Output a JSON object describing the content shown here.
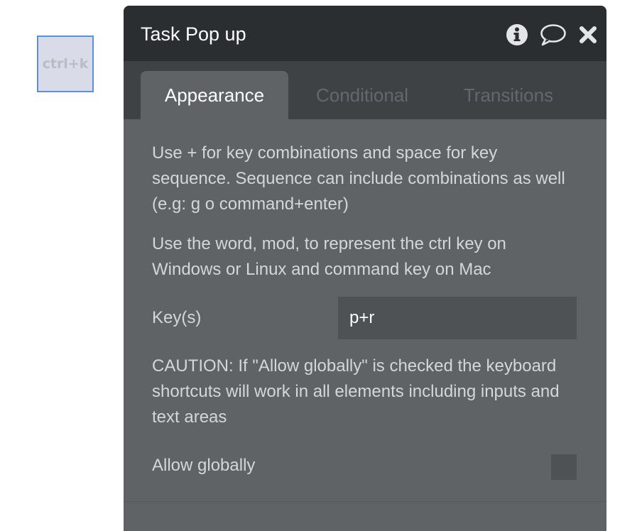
{
  "canvas_element": {
    "label": "ctrl+k"
  },
  "panel": {
    "title": "Task Pop up",
    "header_icons": [
      "info-icon",
      "comment-icon",
      "close-icon"
    ],
    "tabs": [
      {
        "label": "Appearance",
        "active": true
      },
      {
        "label": "Conditional",
        "active": false
      },
      {
        "label": "Transitions",
        "active": false
      }
    ],
    "help_text_1": "Use + for key combinations and space for key sequence. Sequence can include combinations as well (e.g: g o command+enter)",
    "help_text_2": "Use the word, mod, to represent the ctrl key on Windows or Linux and command key on Mac",
    "keys_label": "Key(s)",
    "keys_value": "p+r",
    "caution_text": "CAUTION: If \"Allow globally\" is checked the keyboard shortcuts will work in all elements including inputs and text areas",
    "allow_globally_label": "Allow globally",
    "allow_globally_checked": false
  },
  "colors": {
    "header_bg": "#2b2e31",
    "panel_bg": "#5f6366",
    "tabbar_bg": "#3e4245",
    "selection_border": "#5b8fe0"
  }
}
